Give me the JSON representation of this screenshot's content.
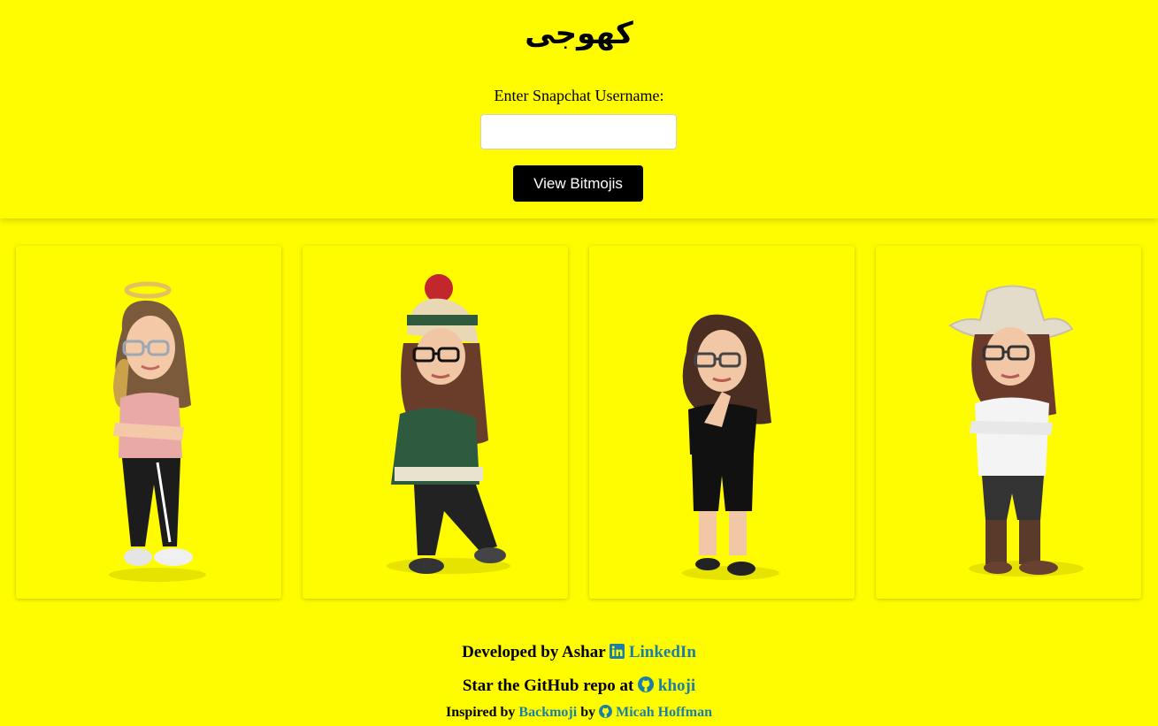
{
  "header": {
    "title": "کھوجی",
    "username_label": "Enter Snapchat Username:",
    "username_value": "",
    "view_button_label": "View Bitmojis"
  },
  "bitmojis": [
    {
      "name": "halo-pink-shirt-bitmoji",
      "icon": "halo-avatar"
    },
    {
      "name": "beanie-green-sweater-bitmoji",
      "icon": "beanie-avatar"
    },
    {
      "name": "black-outfit-bitmoji",
      "icon": "pose-avatar"
    },
    {
      "name": "cowboy-hat-bitmoji",
      "icon": "cowboy-avatar"
    }
  ],
  "footer": {
    "developed_prefix": "Developed by Ashar",
    "linkedin_label": "LinkedIn",
    "github_prefix": "Star the GitHub repo at",
    "repo_label": "khoji",
    "inspired_prefix": "Inspired by",
    "backmoji_label": "Backmoji",
    "by_word": "by",
    "author_label": "Micah Hoffman"
  },
  "colors": {
    "background": "#FFFC00",
    "button": "#000000",
    "link": "#1b7fa6"
  }
}
